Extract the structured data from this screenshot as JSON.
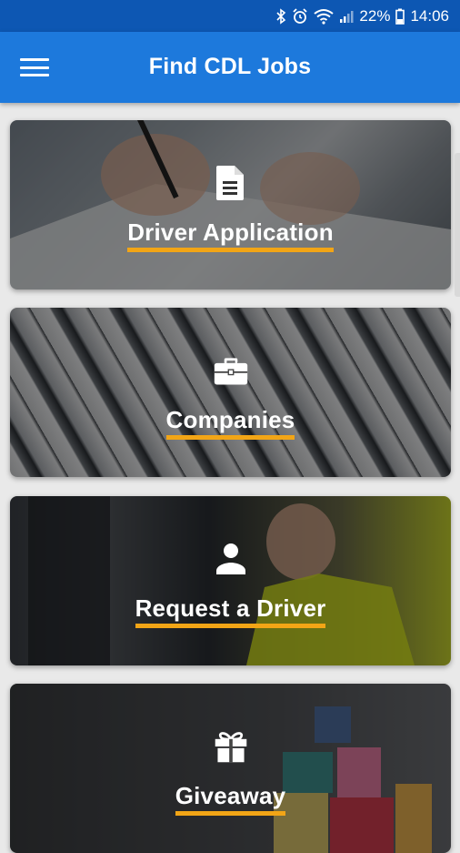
{
  "status": {
    "battery": "22%",
    "time": "14:06"
  },
  "header": {
    "title": "Find CDL Jobs"
  },
  "cards": [
    {
      "label": "Driver Application",
      "icon": "document-icon"
    },
    {
      "label": "Companies",
      "icon": "briefcase-icon"
    },
    {
      "label": "Request a Driver",
      "icon": "person-icon"
    },
    {
      "label": "Giveaway",
      "icon": "gift-icon"
    }
  ],
  "colors": {
    "status_bar": "#0d57b3",
    "app_bar": "#1d79dc",
    "underline": "#f2a516"
  }
}
